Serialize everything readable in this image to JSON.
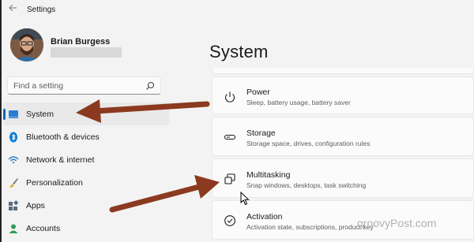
{
  "window": {
    "title": "Settings"
  },
  "user": {
    "name": "Brian Burgess"
  },
  "search": {
    "placeholder": "Find a setting"
  },
  "sidebar": {
    "items": [
      {
        "label": "System",
        "icon": "system-icon",
        "selected": true
      },
      {
        "label": "Bluetooth & devices",
        "icon": "bluetooth-icon"
      },
      {
        "label": "Network & internet",
        "icon": "wifi-icon"
      },
      {
        "label": "Personalization",
        "icon": "brush-icon"
      },
      {
        "label": "Apps",
        "icon": "apps-icon"
      },
      {
        "label": "Accounts",
        "icon": "accounts-icon"
      }
    ]
  },
  "main": {
    "title": "System",
    "cards": [
      {
        "title": "Power",
        "subtitle": "Sleep, battery usage, battery saver",
        "icon": "power-icon"
      },
      {
        "title": "Storage",
        "subtitle": "Storage space, drives, configuration rules",
        "icon": "storage-icon"
      },
      {
        "title": "Multitasking",
        "subtitle": "Snap windows, desktops, task switching",
        "icon": "multitasking-icon"
      },
      {
        "title": "Activation",
        "subtitle": "Activation state, subscriptions, product key",
        "icon": "activation-icon"
      }
    ]
  },
  "watermark": "groovyPost.com",
  "colors": {
    "accent": "#0067c0",
    "arrow": "#8b3a1f",
    "background": "#f3f3f3"
  }
}
